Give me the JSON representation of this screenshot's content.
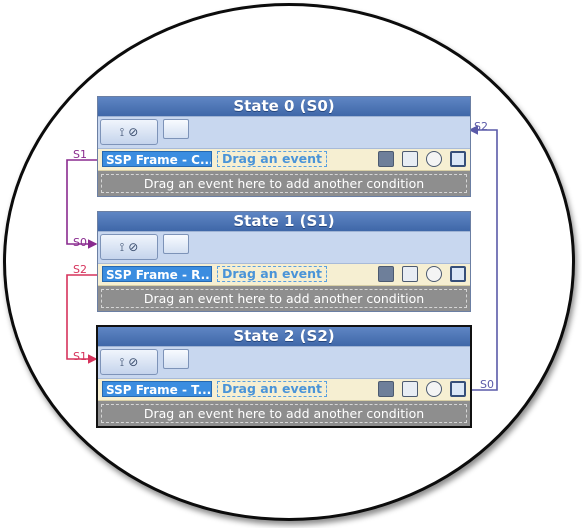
{
  "states": [
    {
      "title": "State 0 (S0)",
      "event_chip": "SSP Frame - C...",
      "drag_event": "Drag an event",
      "drop_hint": "Drag an event here to add another condition"
    },
    {
      "title": "State 1 (S1)",
      "event_chip": "SSP Frame - R...",
      "drag_event": "Drag an event",
      "drop_hint": "Drag an event here to add another condition"
    },
    {
      "title": "State 2 (S2)",
      "event_chip": "SSP Frame - T...",
      "drag_event": "Drag an event",
      "drop_hint": "Drag an event here to add another condition"
    }
  ],
  "transitions": {
    "s0_out": "S1",
    "s1_in": "S0",
    "s1_out": "S2",
    "s2_in": "S1",
    "s2_out": "S0",
    "s0_in": "S2"
  },
  "colors": {
    "purple": "#8a2b8f",
    "pink": "#d6335c",
    "blue": "#5a5aa8",
    "title_bar": "#4a73b5"
  },
  "icons": [
    "filter-icon",
    "collapse-icon",
    "action-icon",
    "save-icon",
    "timer-icon",
    "transition-icon"
  ]
}
